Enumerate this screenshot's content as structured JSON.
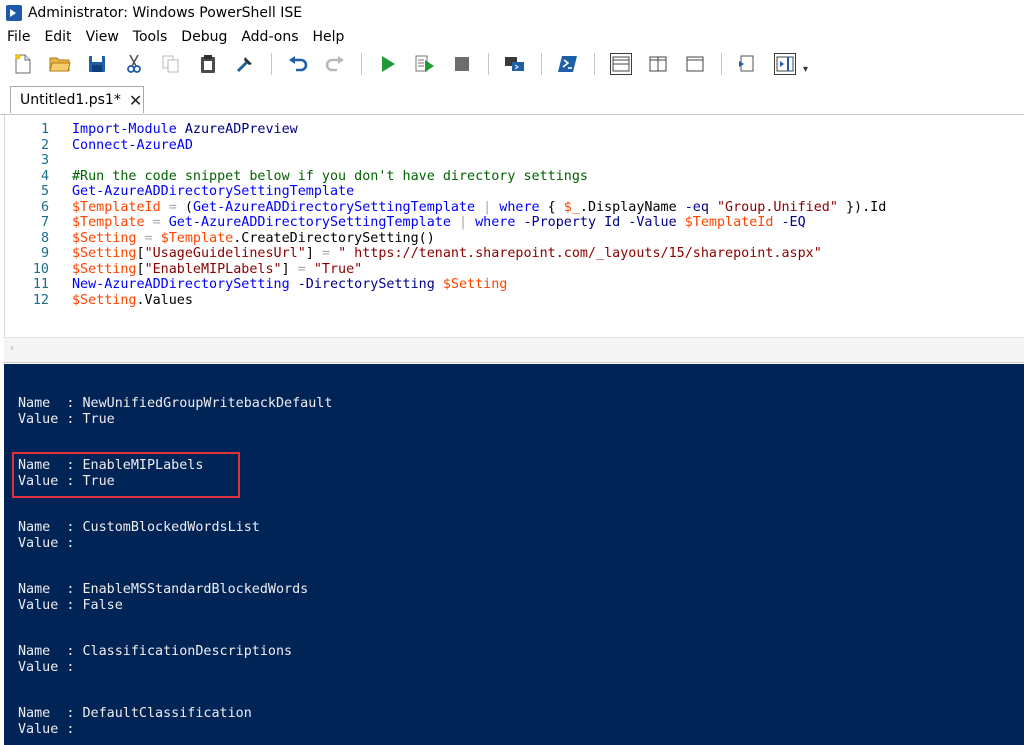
{
  "window": {
    "title": "Administrator: Windows PowerShell ISE"
  },
  "menu": [
    "File",
    "Edit",
    "View",
    "Tools",
    "Debug",
    "Add-ons",
    "Help"
  ],
  "toolbar": {
    "icons": [
      "new-file-icon",
      "open-folder-icon",
      "save-icon",
      "cut-icon",
      "copy-icon",
      "paste-icon",
      "clear-console-icon",
      "undo-icon",
      "redo-icon",
      "run-script-icon",
      "run-selection-icon",
      "stop-icon",
      "remote-powershell-icon",
      "powershell-console-icon",
      "layout-top-icon",
      "layout-right-icon",
      "layout-maximized-icon",
      "show-script-pane-icon",
      "show-command-addon-icon"
    ]
  },
  "tab": {
    "label": "Untitled1.ps1*",
    "close": "✕"
  },
  "editor": {
    "lines": [
      {
        "n": "1",
        "tokens": [
          [
            "cmd",
            "Import-Module"
          ],
          [
            "txt",
            " "
          ],
          [
            "param",
            "AzureADPreview"
          ]
        ]
      },
      {
        "n": "2",
        "tokens": [
          [
            "cmd",
            "Connect-AzureAD"
          ]
        ]
      },
      {
        "n": "3",
        "tokens": []
      },
      {
        "n": "4",
        "tokens": [
          [
            "cmt",
            "#Run the code snippet below if you don't have directory settings"
          ]
        ]
      },
      {
        "n": "5",
        "tokens": [
          [
            "cmd",
            "Get-AzureADDirectorySettingTemplate"
          ]
        ]
      },
      {
        "n": "6",
        "tokens": [
          [
            "var",
            "$TemplateId"
          ],
          [
            "txt",
            " "
          ],
          [
            "op",
            "="
          ],
          [
            "txt",
            " ("
          ],
          [
            "cmd",
            "Get-AzureADDirectorySettingTemplate"
          ],
          [
            "txt",
            " "
          ],
          [
            "op",
            "|"
          ],
          [
            "txt",
            " "
          ],
          [
            "cmd",
            "where"
          ],
          [
            "txt",
            " { "
          ],
          [
            "var",
            "$_"
          ],
          [
            "txt",
            ".DisplayName "
          ],
          [
            "kw",
            "-eq"
          ],
          [
            "txt",
            " "
          ],
          [
            "str",
            "\"Group.Unified\""
          ],
          [
            "txt",
            " }).Id"
          ]
        ]
      },
      {
        "n": "7",
        "tokens": [
          [
            "var",
            "$Template"
          ],
          [
            "txt",
            " "
          ],
          [
            "op",
            "="
          ],
          [
            "txt",
            " "
          ],
          [
            "cmd",
            "Get-AzureADDirectorySettingTemplate"
          ],
          [
            "txt",
            " "
          ],
          [
            "op",
            "|"
          ],
          [
            "txt",
            " "
          ],
          [
            "cmd",
            "where"
          ],
          [
            "txt",
            " "
          ],
          [
            "kw",
            "-Property"
          ],
          [
            "txt",
            " "
          ],
          [
            "param",
            "Id"
          ],
          [
            "txt",
            " "
          ],
          [
            "kw",
            "-Value"
          ],
          [
            "txt",
            " "
          ],
          [
            "var",
            "$TemplateId"
          ],
          [
            "txt",
            " "
          ],
          [
            "kw",
            "-EQ"
          ]
        ]
      },
      {
        "n": "8",
        "tokens": [
          [
            "var",
            "$Setting"
          ],
          [
            "txt",
            " "
          ],
          [
            "op",
            "="
          ],
          [
            "txt",
            " "
          ],
          [
            "var",
            "$Template"
          ],
          [
            "txt",
            ".CreateDirectorySetting()"
          ]
        ]
      },
      {
        "n": "9",
        "tokens": [
          [
            "var",
            "$Setting"
          ],
          [
            "txt",
            "["
          ],
          [
            "str",
            "\"UsageGuidelinesUrl\""
          ],
          [
            "txt",
            "] "
          ],
          [
            "op",
            "="
          ],
          [
            "txt",
            " "
          ],
          [
            "str",
            "\" https://tenant.sharepoint.com/_layouts/15/sharepoint.aspx\""
          ]
        ]
      },
      {
        "n": "10",
        "tokens": [
          [
            "var",
            "$Setting"
          ],
          [
            "txt",
            "["
          ],
          [
            "str",
            "\"EnableMIPLabels\""
          ],
          [
            "txt",
            "] "
          ],
          [
            "op",
            "="
          ],
          [
            "txt",
            " "
          ],
          [
            "str",
            "\"True\""
          ]
        ]
      },
      {
        "n": "11",
        "tokens": [
          [
            "cmd",
            "New-AzureADDirectorySetting"
          ],
          [
            "txt",
            " "
          ],
          [
            "kw",
            "-DirectorySetting"
          ],
          [
            "txt",
            " "
          ],
          [
            "var",
            "$Setting"
          ]
        ]
      },
      {
        "n": "12",
        "tokens": [
          [
            "var",
            "$Setting"
          ],
          [
            "txt",
            ".Values"
          ]
        ]
      }
    ]
  },
  "console": {
    "entries": [
      {
        "name": "NewUnifiedGroupWritebackDefault",
        "value": "True"
      },
      {
        "name": "EnableMIPLabels",
        "value": "True"
      },
      {
        "name": "CustomBlockedWordsList",
        "value": ""
      },
      {
        "name": "EnableMSStandardBlockedWords",
        "value": "False"
      },
      {
        "name": "ClassificationDescriptions",
        "value": ""
      },
      {
        "name": "DefaultClassification",
        "value": ""
      }
    ],
    "name_prefix": "Name  : ",
    "value_prefix": "Value : "
  },
  "colors": {
    "console_bg": "#012456",
    "console_text": "#eeedf0",
    "highlight": "#e0323a",
    "cmd": "#0000ff",
    "variable": "#ff4500",
    "string": "#8b0000",
    "comment": "#006400"
  }
}
